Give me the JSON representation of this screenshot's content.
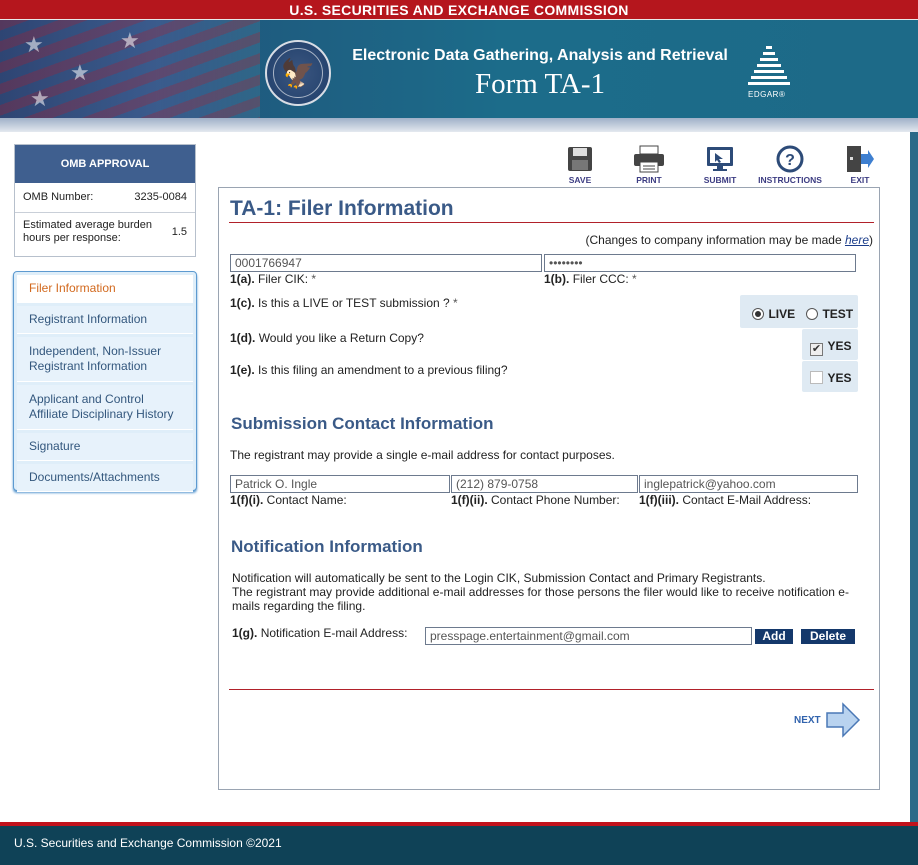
{
  "header": {
    "agency": "U.S. SECURITIES AND EXCHANGE COMMISSION",
    "system_title": "Electronic Data Gathering, Analysis and Retrieval",
    "form_title": "Form TA-1",
    "logo_text": "EDGAR®"
  },
  "omb": {
    "title": "OMB APPROVAL",
    "number_label": "OMB Number:",
    "number_value": "3235-0084",
    "burden_label": "Estimated average burden hours per response:",
    "burden_value": "1.5"
  },
  "sidebar": {
    "items": [
      {
        "label": "Filer Information",
        "active": true
      },
      {
        "label": "Registrant Information",
        "active": false
      },
      {
        "label": "Independent, Non-Issuer Registrant Information",
        "active": false
      },
      {
        "label": "Applicant and Control Affiliate Disciplinary History",
        "active": false
      },
      {
        "label": "Signature",
        "active": false
      },
      {
        "label": "Documents/Attachments",
        "active": false
      }
    ]
  },
  "toolbar": {
    "save": "SAVE",
    "print": "PRINT",
    "submit": "SUBMIT",
    "instructions": "INSTRUCTIONS",
    "exit": "EXIT"
  },
  "form": {
    "title": "TA-1: Filer Information",
    "change_note": "(Changes to company information may be made ",
    "change_link": "here",
    "change_close": ")",
    "filer_cik_value": "0001766947",
    "filer_cik_num": "1(a).",
    "filer_cik_label": "Filer CIK:",
    "filer_ccc_value": "••••••••",
    "filer_ccc_num": "1(b).",
    "filer_ccc_label": "Filer CCC:",
    "required_mark": "*",
    "q_live_num": "1(c).",
    "q_live_label": "Is this a LIVE or TEST submission ?",
    "opt_live": "LIVE",
    "opt_test": "TEST",
    "live_selected": true,
    "q_copy_num": "1(d).",
    "q_copy_label": "Would you like a Return Copy?",
    "copy_yes": "YES",
    "copy_checked": true,
    "q_amend_num": "1(e).",
    "q_amend_label": "Is this filing an amendment to a previous filing?",
    "amend_yes": "YES",
    "amend_checked": false
  },
  "contact": {
    "heading": "Submission Contact Information",
    "description": "The registrant may provide a single e-mail address for contact purposes.",
    "name_value": "Patrick O. Ingle",
    "phone_value": "(212) 879-0758",
    "email_value": "inglepatrick@yahoo.com",
    "name_num": "1(f)(i).",
    "name_label": "Contact Name:",
    "phone_num": "1(f)(ii).",
    "phone_label": "Contact Phone Number:",
    "email_num": "1(f)(iii).",
    "email_label": "Contact E-Mail Address:"
  },
  "notification": {
    "heading": "Notification Information",
    "text1": "Notification will automatically be sent to the Login CIK, Submission Contact and Primary Registrants.",
    "text2": "The registrant may provide additional e-mail addresses for those persons the filer would like to receive notification e-mails regarding the filing.",
    "email_num": "1(g).",
    "email_label": "Notification E-mail Address:",
    "email_value": "presspage.entertainment@gmail.com",
    "add_label": "Add",
    "delete_label": "Delete"
  },
  "nav": {
    "next_label": "NEXT"
  },
  "footer": {
    "text": "U.S. Securities and Exchange Commission ©2021"
  },
  "colors": {
    "agency_bar": "#b5161d",
    "heading_blue": "#3a5a87",
    "button_navy": "#14386b",
    "active_nav": "#d2691e"
  }
}
